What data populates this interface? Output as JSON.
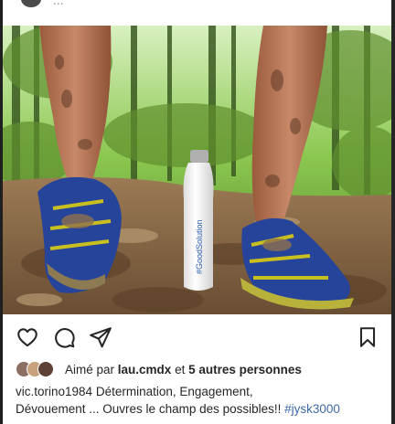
{
  "header": {
    "username_partial": "..."
  },
  "photo": {
    "bottle_text": "#GoodSolution"
  },
  "actions": {
    "like_icon": "heart-outline-icon",
    "comment_icon": "comment-bubble-icon",
    "share_icon": "paper-plane-icon",
    "save_icon": "bookmark-icon"
  },
  "likes": {
    "prefix": "Aimé par ",
    "user": "lau.cmdx",
    "middle": " et ",
    "others": "5 autres personnes"
  },
  "caption": {
    "username": "vic.torino1984",
    "line1": " Détermination, Engagement,",
    "line2": "Dévouement ... Ouvres le champ des possibles!! ",
    "hashtag": "#jysk3000"
  },
  "colors": {
    "hashtag": "#3d6aa8",
    "text": "#262626"
  }
}
